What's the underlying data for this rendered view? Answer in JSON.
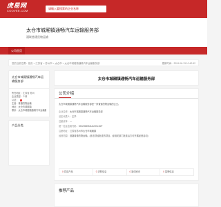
{
  "brand": {
    "logo_main": "虎易网",
    "logo_sub": "COOVEE.COM"
  },
  "search": {
    "text": "请输入要搜索的企业名称"
  },
  "header": {
    "title": "太仓市城厢镇通畅汽车运输服务部",
    "subtitle": "通联普通货物运输"
  },
  "nav": {
    "home": "公司首页"
  },
  "breadcrumb": {
    "path": "您的当前位置：首页 > 江苏省 > 苏州市 > 太仓市 > 太仓市城厢镇通畅汽车运输服务部",
    "updated": "更新时间：2024-06-13 10:42:52"
  },
  "sidebar": {
    "company_name": "太仓市城厢镇通畅汽车运输服务部",
    "rows": [
      "所在地区：江苏省 苏州",
      "企业类型：个体",
      "认证：",
      "主营：普通货物运输",
      "地址：太仓市城厢镇",
      "联系：太仓市城厢镇通畅汽车运输服务部"
    ],
    "products_title": "产品分类"
  },
  "main": {
    "company_name": "太仓市城厢镇通畅汽车运输服务部",
    "intro_title": "公司介绍",
    "intro_text": "太仓市城厢镇通畅汽车运输服务部是一家普通货物运输的企业。",
    "info_rows": [
      {
        "label": "企业名称：",
        "value": "太仓市城厢镇通畅汽车运输服务部"
      },
      {
        "label": "法定代表人：",
        "value": "王华"
      },
      {
        "label": "注册资本：",
        "value": "—"
      },
      {
        "label": "统一社会信用代码：",
        "value": "92320585MA1MJKLB2F"
      },
      {
        "label": "注册地址：",
        "value": "江苏省苏州市太仓市城厢镇"
      },
      {
        "label": "经营范围：",
        "value": "道路普通货物运输。(依法须经批准的项目，经相关部门批准后方可开展经营活动)"
      }
    ],
    "stats": [
      {
        "num": "0",
        "label": "供应产品"
      },
      {
        "num": "0",
        "label": "求购信息"
      },
      {
        "num": "0",
        "label": "新闻资讯"
      },
      {
        "num": "0",
        "label": "招聘信息"
      }
    ],
    "recommend_title": "推荐产品"
  },
  "colors": {
    "brand_red": "#c62828"
  }
}
